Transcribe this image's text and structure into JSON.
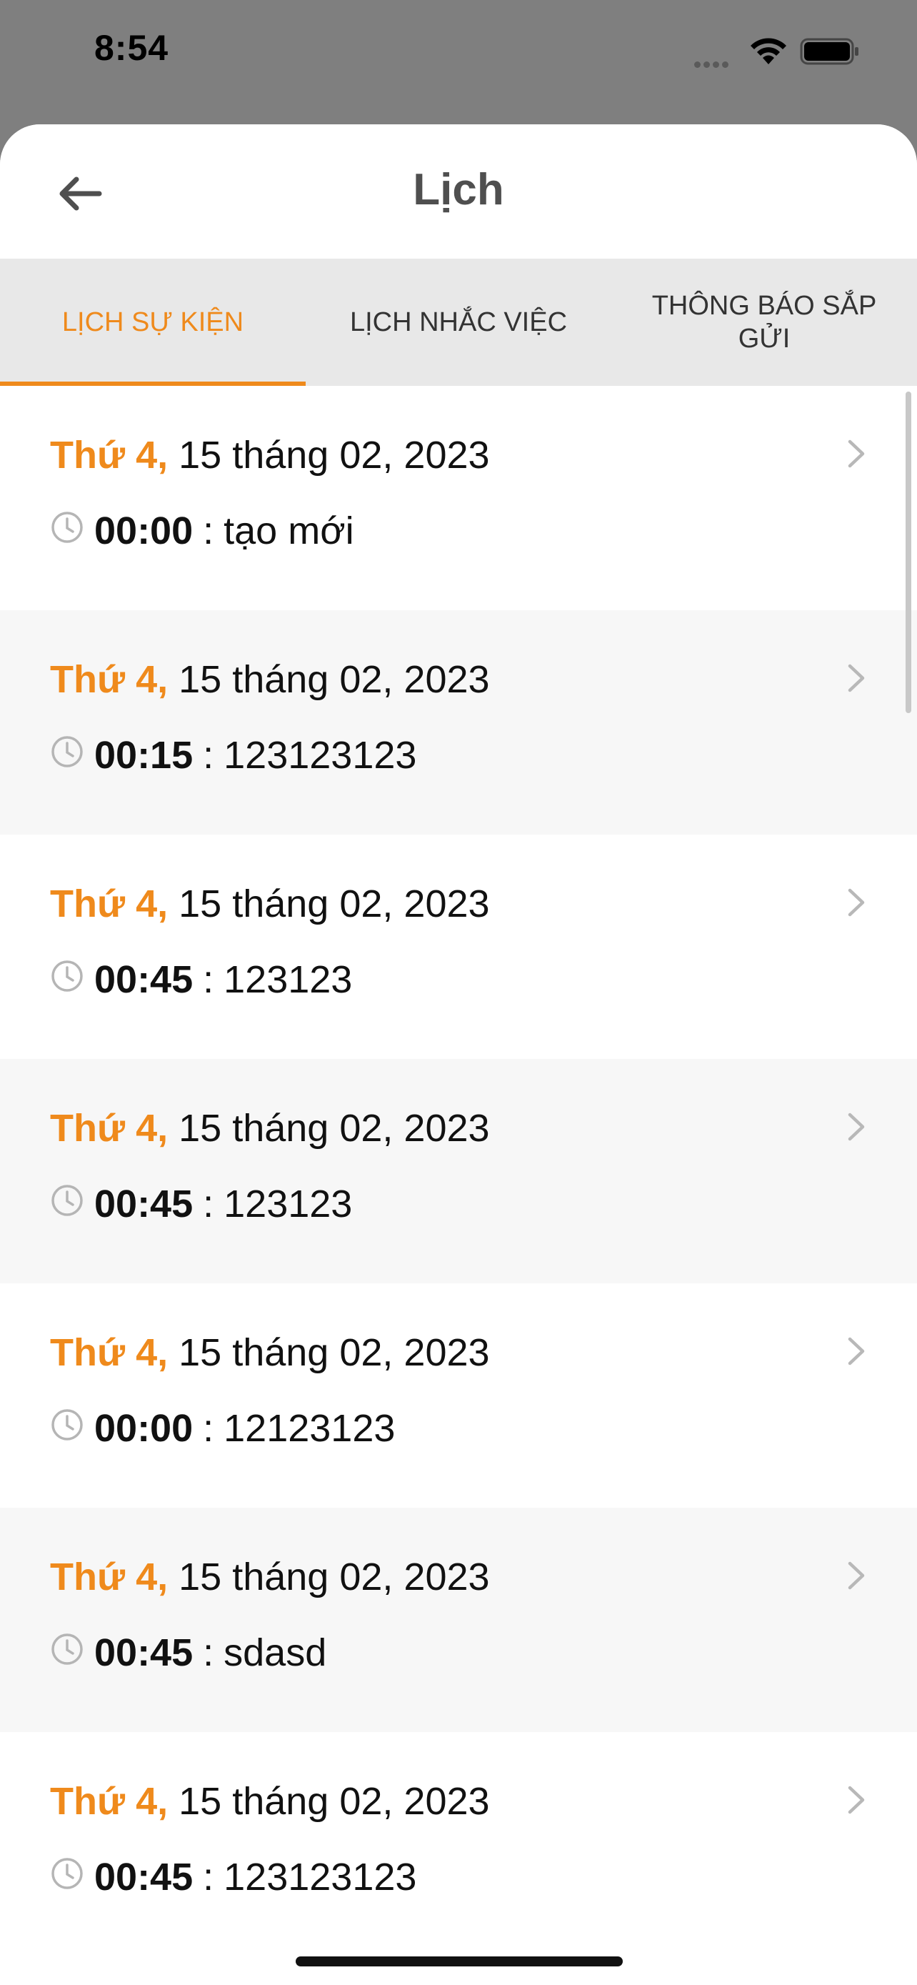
{
  "status_bar": {
    "time": "8:54"
  },
  "header": {
    "title": "Lịch",
    "back_icon": "arrow-left-icon"
  },
  "tabs": [
    {
      "label": "LỊCH SỰ KIỆN",
      "active": true
    },
    {
      "label": "LỊCH NHẮC VIỆC",
      "active": false
    },
    {
      "label": "THÔNG BÁO SẮP GỬI",
      "active": false
    }
  ],
  "events": [
    {
      "weekday": "Thứ 4,",
      "date": "15 tháng 02, 2023",
      "time": "00:00",
      "separator": ":",
      "title": "tạo mới"
    },
    {
      "weekday": "Thứ 4,",
      "date": "15 tháng 02, 2023",
      "time": "00:15",
      "separator": ":",
      "title": "123123123"
    },
    {
      "weekday": "Thứ 4,",
      "date": "15 tháng 02, 2023",
      "time": "00:45",
      "separator": ":",
      "title": "123123"
    },
    {
      "weekday": "Thứ 4,",
      "date": "15 tháng 02, 2023",
      "time": "00:45",
      "separator": ":",
      "title": "123123"
    },
    {
      "weekday": "Thứ 4,",
      "date": "15 tháng 02, 2023",
      "time": "00:00",
      "separator": ":",
      "title": "12123123"
    },
    {
      "weekday": "Thứ 4,",
      "date": "15 tháng 02, 2023",
      "time": "00:45",
      "separator": ":",
      "title": "sdasd"
    },
    {
      "weekday": "Thứ 4,",
      "date": "15 tháng 02, 2023",
      "time": "00:45",
      "separator": ":",
      "title": "123123123"
    }
  ],
  "colors": {
    "accent": "#ef8a1c",
    "tab_background": "#e8e8e8",
    "row_alt": "#f7f7f7",
    "backdrop": "#7f7f7f"
  }
}
